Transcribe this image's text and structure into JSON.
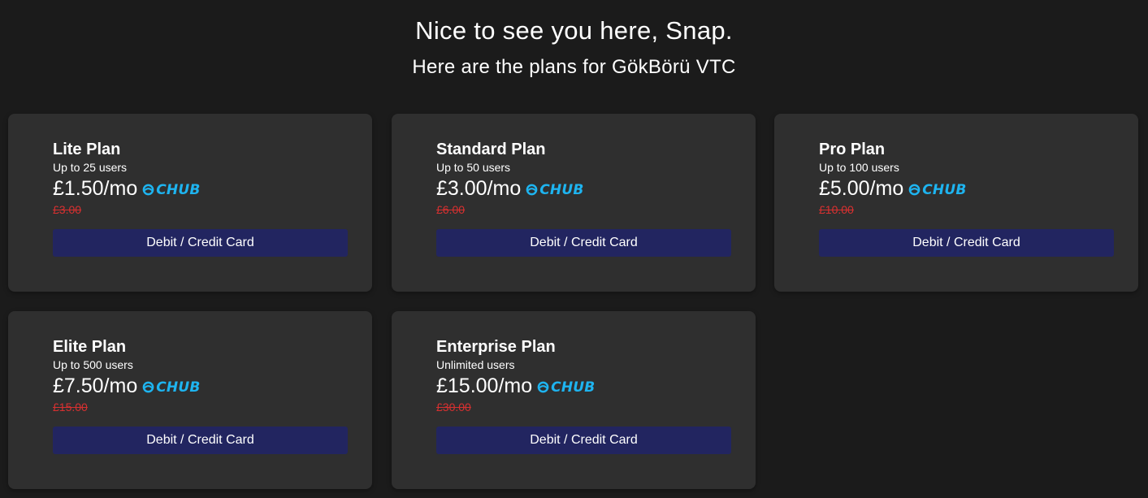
{
  "header": {
    "greeting": "Nice to see you here, Snap.",
    "subtitle": "Here are the plans for GökBörü VTC"
  },
  "brand": {
    "name": "CHUB",
    "icon": "chub-logo-icon",
    "color": "#1eb4f0"
  },
  "colors": {
    "background": "#1b1b1b",
    "card": "#2f2f2f",
    "button": "#222560",
    "old_price": "#d83030"
  },
  "plans": [
    {
      "name": "Lite Plan",
      "users": "Up to 25 users",
      "price": "£1.50/mo",
      "old_price": "£3.00",
      "button_label": "Debit / Credit Card"
    },
    {
      "name": "Standard Plan",
      "users": "Up to 50 users",
      "price": "£3.00/mo",
      "old_price": "£6.00",
      "button_label": "Debit / Credit Card"
    },
    {
      "name": "Pro Plan",
      "users": "Up to 100 users",
      "price": "£5.00/mo",
      "old_price": "£10.00",
      "button_label": "Debit / Credit Card"
    },
    {
      "name": "Elite Plan",
      "users": "Up to 500 users",
      "price": "£7.50/mo",
      "old_price": "£15.00",
      "button_label": "Debit / Credit Card"
    },
    {
      "name": "Enterprise Plan",
      "users": "Unlimited users",
      "price": "£15.00/mo",
      "old_price": "£30.00",
      "button_label": "Debit / Credit Card"
    }
  ]
}
